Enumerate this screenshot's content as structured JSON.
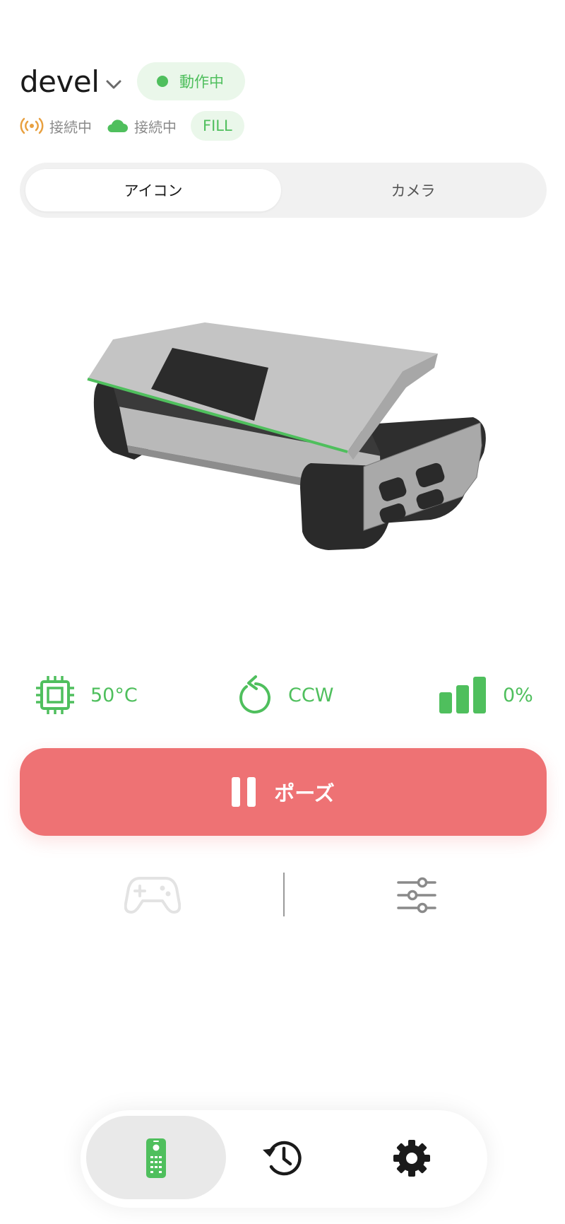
{
  "header": {
    "device_name": "devel",
    "status_label": "動作中",
    "connections": [
      {
        "icon": "antenna-icon",
        "label": "接続中"
      },
      {
        "icon": "cloud-icon",
        "label": "接続中"
      }
    ],
    "mode_badge": "FILL"
  },
  "tabs": [
    {
      "label": "アイコン",
      "selected": true
    },
    {
      "label": "カメラ",
      "selected": false
    }
  ],
  "stats": {
    "temperature": "50°C",
    "rotation": "CCW",
    "level": "0%"
  },
  "pause_label": "ポーズ",
  "controls": [
    {
      "icon": "gamepad-icon",
      "enabled": false
    },
    {
      "icon": "sliders-icon",
      "enabled": true
    }
  ],
  "bottom_nav": [
    {
      "icon": "remote-icon",
      "selected": true
    },
    {
      "icon": "history-icon",
      "selected": false
    },
    {
      "icon": "gear-icon",
      "selected": false
    }
  ],
  "colors": {
    "accent": "#4fbf5d",
    "pause": "#ee7274",
    "antenna": "#e8a040"
  }
}
